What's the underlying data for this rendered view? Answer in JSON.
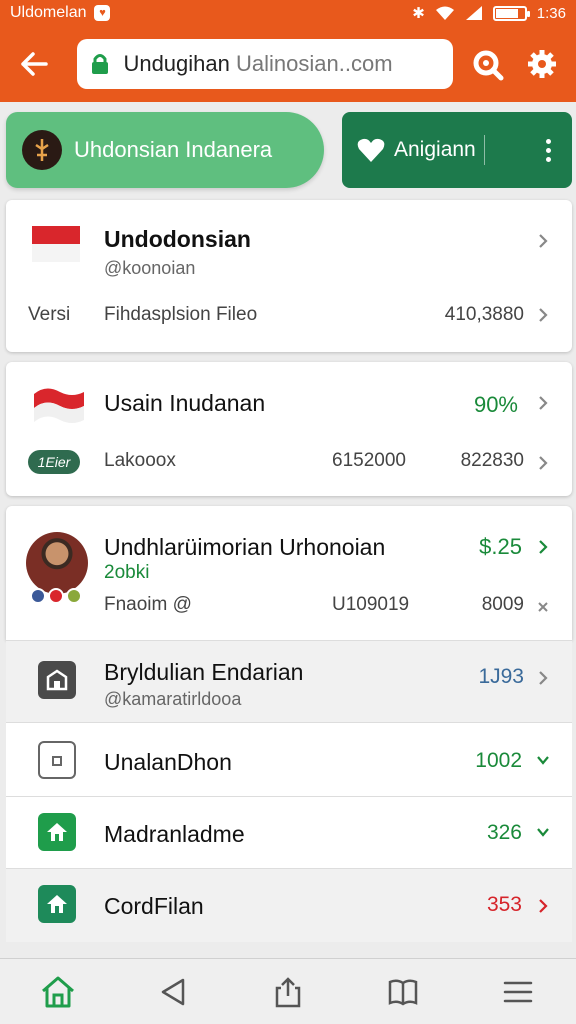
{
  "status_bar": {
    "app_name": "Uldomelan",
    "time": "1:36",
    "battery_level": 0.85
  },
  "toolbar": {
    "url_main": "Undugihan",
    "url_dim": " Ualinosian..com"
  },
  "actions": {
    "primary_label": "Uhdonsian Indanera",
    "secondary_label": "Anigiann"
  },
  "cards": {
    "card1": {
      "title": "Undodonsian",
      "handle": "@koonoian",
      "meta_label": "Versi",
      "meta_value": "Fihdasplsion Fileo",
      "number": "410,3880"
    },
    "card2": {
      "title": "Usain Inudanan",
      "percent": "90%",
      "badge": "1Eier",
      "label": "Lakooox",
      "value1": "6152000",
      "value2": "822830"
    },
    "card3": {
      "title": "Undhlarüimorian Urhonoian",
      "subtitle": "2obki",
      "price": "$.25",
      "label": "Fnaoim @",
      "value1": "U109019",
      "value2": "8009"
    }
  },
  "list": [
    {
      "title": "Bryldulian Endarian",
      "handle": "@kamaratirldooa",
      "value": "1J93",
      "icon": "store-icon"
    },
    {
      "title": "UnalanDhon",
      "value": "1002",
      "icon": "box-icon"
    },
    {
      "title": "Madranladme",
      "value": "326",
      "icon": "home-icon"
    },
    {
      "title": "CordFilan",
      "value": "353",
      "icon": "house-icon"
    }
  ],
  "colors": {
    "brand": "#e8591c",
    "primary_button": "#5fbf7f",
    "secondary_button": "#1d7a4c",
    "positive": "#1a8a3a",
    "negative": "#d6242a"
  }
}
